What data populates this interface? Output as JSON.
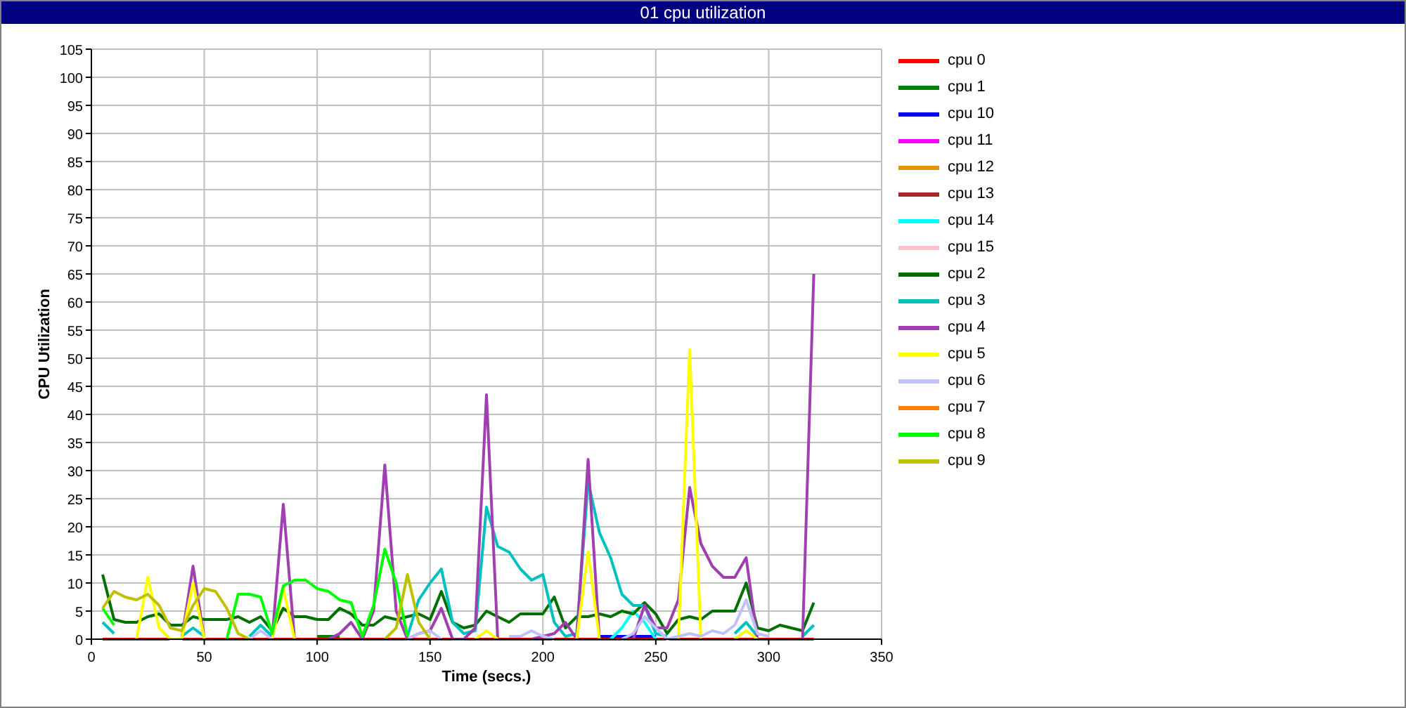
{
  "panel": {
    "title": "01 cpu utilization",
    "chart_data": {
      "type": "line",
      "grid": true,
      "xlabel": "Time (secs.)",
      "ylabel": "CPU Utilization",
      "x": [
        5,
        10,
        15,
        20,
        25,
        30,
        35,
        40,
        45,
        50,
        55,
        60,
        65,
        70,
        75,
        80,
        85,
        90,
        95,
        100,
        105,
        110,
        115,
        120,
        125,
        130,
        135,
        140,
        145,
        150,
        155,
        160,
        165,
        170,
        175,
        180,
        185,
        190,
        195,
        200,
        205,
        210,
        215,
        220,
        225,
        230,
        235,
        240,
        245,
        250,
        255,
        260,
        265,
        270,
        275,
        280,
        285,
        290,
        295,
        300,
        305,
        310,
        315,
        320
      ],
      "xlim": [
        0,
        350
      ],
      "ylim": [
        0,
        105
      ],
      "xticks": [
        0,
        50,
        100,
        150,
        200,
        250,
        300,
        350
      ],
      "yticks": [
        0,
        5,
        10,
        15,
        20,
        25,
        30,
        35,
        40,
        45,
        50,
        55,
        60,
        65,
        70,
        75,
        80,
        85,
        90,
        95,
        100,
        105
      ],
      "series": [
        {
          "name": "cpu 0",
          "color": "#ff0000",
          "values": [
            0,
            0,
            0,
            0,
            0,
            0,
            0,
            0,
            0,
            0,
            0,
            0,
            0,
            0,
            0,
            0,
            0,
            0,
            0,
            0,
            0,
            0,
            0,
            0,
            0,
            0,
            0,
            0,
            0,
            0,
            0,
            0,
            0,
            0,
            0,
            0,
            0,
            0,
            0,
            0,
            0,
            0,
            0,
            0,
            0,
            0,
            0,
            0,
            0,
            0,
            0,
            0,
            0,
            0,
            0,
            0,
            0,
            0,
            0,
            0,
            0,
            0,
            0,
            0
          ]
        },
        {
          "name": "cpu 1",
          "color": "#008000",
          "values": [
            null,
            null,
            null,
            null,
            null,
            null,
            null,
            null,
            null,
            null,
            null,
            null,
            null,
            null,
            null,
            null,
            null,
            null,
            null,
            0.5,
            0.5,
            0.5,
            null,
            null,
            null,
            null,
            null,
            null,
            null,
            null,
            null,
            null,
            null,
            null,
            null,
            null,
            null,
            null,
            null,
            null,
            null,
            null,
            null,
            null,
            null,
            null,
            null,
            null,
            null,
            null,
            null,
            null,
            null,
            null,
            null,
            null,
            null,
            null,
            null,
            null,
            null,
            null,
            null,
            null
          ]
        },
        {
          "name": "cpu 10",
          "color": "#0000ff",
          "values": [
            null,
            null,
            null,
            null,
            null,
            null,
            null,
            null,
            null,
            null,
            null,
            null,
            null,
            null,
            null,
            null,
            null,
            null,
            null,
            null,
            null,
            null,
            null,
            null,
            null,
            null,
            null,
            null,
            null,
            null,
            null,
            null,
            null,
            null,
            null,
            null,
            null,
            null,
            null,
            null,
            null,
            null,
            null,
            null,
            0.5,
            0.5,
            0.5,
            0.5,
            0.5,
            0.5,
            null,
            null,
            null,
            null,
            null,
            null,
            null,
            null,
            null,
            null,
            null,
            null,
            null,
            null
          ]
        },
        {
          "name": "cpu 11",
          "color": "#ff00ff",
          "values": [
            null,
            null,
            null,
            null,
            null,
            null,
            null,
            null,
            null,
            null,
            null,
            null,
            null,
            null,
            null,
            null,
            null,
            null,
            null,
            null,
            null,
            null,
            null,
            null,
            null,
            null,
            null,
            null,
            null,
            null,
            null,
            null,
            null,
            null,
            null,
            null,
            null,
            null,
            null,
            null,
            null,
            null,
            null,
            null,
            null,
            null,
            null,
            null,
            null,
            null,
            null,
            null,
            null,
            null,
            null,
            null,
            null,
            null,
            null,
            null,
            null,
            null,
            null,
            null
          ]
        },
        {
          "name": "cpu 12",
          "color": "#e69500",
          "values": [
            null,
            null,
            null,
            null,
            null,
            null,
            null,
            null,
            null,
            null,
            null,
            null,
            null,
            null,
            null,
            null,
            null,
            null,
            null,
            null,
            null,
            null,
            null,
            null,
            null,
            null,
            null,
            null,
            null,
            null,
            null,
            null,
            null,
            null,
            null,
            null,
            null,
            null,
            null,
            null,
            null,
            null,
            null,
            null,
            null,
            null,
            null,
            null,
            null,
            null,
            null,
            null,
            null,
            null,
            null,
            null,
            null,
            null,
            null,
            null,
            null,
            null,
            null,
            null
          ]
        },
        {
          "name": "cpu 13",
          "color": "#a52a2a",
          "values": [
            null,
            null,
            null,
            null,
            null,
            null,
            null,
            null,
            null,
            null,
            null,
            null,
            null,
            null,
            null,
            null,
            null,
            null,
            null,
            null,
            null,
            null,
            null,
            null,
            null,
            null,
            null,
            null,
            null,
            null,
            null,
            null,
            null,
            null,
            null,
            null,
            null,
            null,
            null,
            null,
            null,
            null,
            null,
            null,
            null,
            null,
            null,
            null,
            null,
            null,
            null,
            null,
            null,
            null,
            null,
            null,
            null,
            null,
            null,
            null,
            null,
            null,
            null,
            null
          ]
        },
        {
          "name": "cpu 14",
          "color": "#00ffff",
          "values": [
            null,
            null,
            null,
            null,
            null,
            null,
            null,
            null,
            null,
            null,
            null,
            null,
            null,
            null,
            null,
            null,
            null,
            null,
            null,
            null,
            null,
            null,
            null,
            null,
            null,
            null,
            null,
            null,
            null,
            null,
            null,
            null,
            null,
            null,
            null,
            null,
            null,
            null,
            null,
            null,
            null,
            null,
            null,
            null,
            null,
            0,
            2,
            5,
            3,
            0,
            null,
            null,
            null,
            null,
            null,
            null,
            null,
            null,
            null,
            null,
            null,
            null,
            null,
            null
          ]
        },
        {
          "name": "cpu 15",
          "color": "#ffc0cb",
          "values": [
            null,
            null,
            null,
            null,
            null,
            null,
            null,
            null,
            null,
            null,
            null,
            null,
            null,
            null,
            null,
            null,
            null,
            null,
            null,
            null,
            null,
            null,
            null,
            null,
            null,
            null,
            null,
            null,
            null,
            null,
            null,
            null,
            null,
            null,
            null,
            null,
            null,
            null,
            null,
            null,
            null,
            null,
            null,
            null,
            null,
            null,
            null,
            null,
            null,
            null,
            null,
            null,
            null,
            null,
            null,
            null,
            null,
            null,
            null,
            null,
            null,
            null,
            null,
            null
          ]
        },
        {
          "name": "cpu 2",
          "color": "#007000",
          "values": [
            11.5,
            3.5,
            3,
            3,
            4,
            4.5,
            2.5,
            2.5,
            4,
            3.5,
            3.5,
            3.5,
            4,
            3,
            4,
            1.5,
            5.5,
            4,
            4,
            3.5,
            3.5,
            5.5,
            4.5,
            2.5,
            2.5,
            4,
            3.5,
            4,
            4.5,
            3.5,
            8.5,
            3,
            2,
            2.5,
            5,
            4,
            3,
            4.5,
            4.5,
            4.5,
            7.5,
            2,
            4,
            4,
            4.5,
            4,
            5,
            4.5,
            6.5,
            4.5,
            1,
            3.5,
            4,
            3.5,
            5,
            5,
            5,
            10,
            2,
            1.5,
            2.5,
            2,
            1.5,
            6.5
          ]
        },
        {
          "name": "cpu 3",
          "color": "#00c0c0",
          "values": [
            3,
            1,
            null,
            null,
            null,
            null,
            null,
            0.5,
            2,
            0.5,
            null,
            null,
            null,
            0.5,
            2.5,
            0.5,
            null,
            null,
            null,
            null,
            null,
            null,
            null,
            null,
            null,
            null,
            null,
            0.5,
            7,
            10,
            12.5,
            3,
            1,
            1.5,
            23.5,
            16.5,
            15.5,
            12.5,
            10.5,
            11.5,
            3,
            0.5,
            1,
            28,
            19,
            14.5,
            8,
            6,
            6,
            1,
            0.5,
            null,
            null,
            null,
            null,
            null,
            1,
            3,
            0.5,
            null,
            null,
            null,
            0.5,
            2.5
          ]
        },
        {
          "name": "cpu 4",
          "color": "#a040b0",
          "values": [
            null,
            null,
            null,
            null,
            null,
            null,
            null,
            0,
            13,
            0,
            null,
            null,
            null,
            null,
            null,
            0,
            24,
            0,
            null,
            null,
            0,
            1,
            3,
            0,
            5,
            31,
            5,
            0,
            1,
            1.5,
            5.5,
            0,
            0,
            2,
            43.5,
            0,
            null,
            null,
            0,
            0.5,
            1,
            3,
            0,
            32,
            0,
            null,
            null,
            0,
            6,
            2,
            2,
            7,
            27,
            17,
            13,
            11,
            11,
            14.5,
            0,
            null,
            null,
            null,
            0,
            65
          ]
        },
        {
          "name": "cpu 5",
          "color": "#ffff00",
          "values": [
            null,
            null,
            null,
            0,
            11,
            2,
            0,
            0,
            10,
            0,
            null,
            null,
            null,
            null,
            null,
            0,
            9,
            0,
            null,
            null,
            null,
            null,
            null,
            null,
            null,
            null,
            null,
            null,
            null,
            null,
            null,
            null,
            null,
            0,
            1.5,
            0,
            null,
            null,
            null,
            null,
            null,
            null,
            0,
            15.5,
            0,
            null,
            null,
            null,
            null,
            null,
            null,
            0,
            51.5,
            0,
            null,
            null,
            0,
            1.5,
            0,
            null,
            null,
            null,
            null,
            null
          ]
        },
        {
          "name": "cpu 6",
          "color": "#c0c0ff",
          "values": [
            null,
            null,
            null,
            null,
            null,
            null,
            null,
            null,
            null,
            null,
            null,
            null,
            null,
            0,
            1.5,
            0,
            null,
            null,
            null,
            null,
            null,
            null,
            null,
            null,
            null,
            null,
            null,
            0,
            1,
            1.5,
            0,
            null,
            null,
            null,
            null,
            null,
            0.5,
            0.5,
            1.5,
            0.5,
            0,
            null,
            null,
            null,
            null,
            null,
            0,
            1,
            4,
            2,
            0,
            0.5,
            1,
            0.5,
            1.5,
            1,
            2.5,
            7,
            1,
            0.5,
            null,
            null,
            null,
            null
          ]
        },
        {
          "name": "cpu 7",
          "color": "#ff8000",
          "values": [
            null,
            null,
            null,
            null,
            null,
            null,
            null,
            null,
            null,
            null,
            null,
            null,
            null,
            null,
            null,
            null,
            null,
            null,
            null,
            null,
            null,
            null,
            null,
            null,
            null,
            null,
            null,
            null,
            null,
            null,
            null,
            null,
            null,
            null,
            null,
            null,
            null,
            null,
            null,
            null,
            null,
            null,
            null,
            null,
            null,
            null,
            null,
            null,
            null,
            null,
            null,
            null,
            null,
            null,
            null,
            null,
            null,
            null,
            null,
            null,
            null,
            null,
            null,
            null
          ]
        },
        {
          "name": "cpu 8",
          "color": "#00ff00",
          "values": [
            5.5,
            2.5,
            null,
            null,
            null,
            null,
            null,
            null,
            null,
            null,
            null,
            0,
            8,
            8,
            7.5,
            1,
            9.5,
            10.5,
            10.5,
            9,
            8.5,
            7,
            6.5,
            0.5,
            6,
            16,
            10,
            0.5,
            null,
            null,
            null,
            null,
            null,
            null,
            null,
            null,
            null,
            null,
            null,
            null,
            null,
            null,
            null,
            null,
            null,
            null,
            null,
            null,
            null,
            null,
            null,
            null,
            null,
            null,
            null,
            null,
            null,
            null,
            null,
            null,
            null,
            null,
            null,
            null
          ]
        },
        {
          "name": "cpu 9",
          "color": "#c0c000",
          "values": [
            5.5,
            8.5,
            7.5,
            7,
            8,
            6,
            2,
            1.5,
            6,
            9,
            8.5,
            5.5,
            1,
            0,
            null,
            null,
            null,
            null,
            null,
            null,
            null,
            null,
            null,
            null,
            null,
            0,
            2,
            11.5,
            3,
            0,
            null,
            null,
            null,
            null,
            null,
            null,
            null,
            null,
            null,
            null,
            null,
            null,
            null,
            null,
            null,
            null,
            null,
            null,
            null,
            null,
            null,
            null,
            null,
            null,
            null,
            null,
            null,
            null,
            null,
            null,
            null,
            null,
            null,
            null
          ]
        }
      ]
    }
  }
}
